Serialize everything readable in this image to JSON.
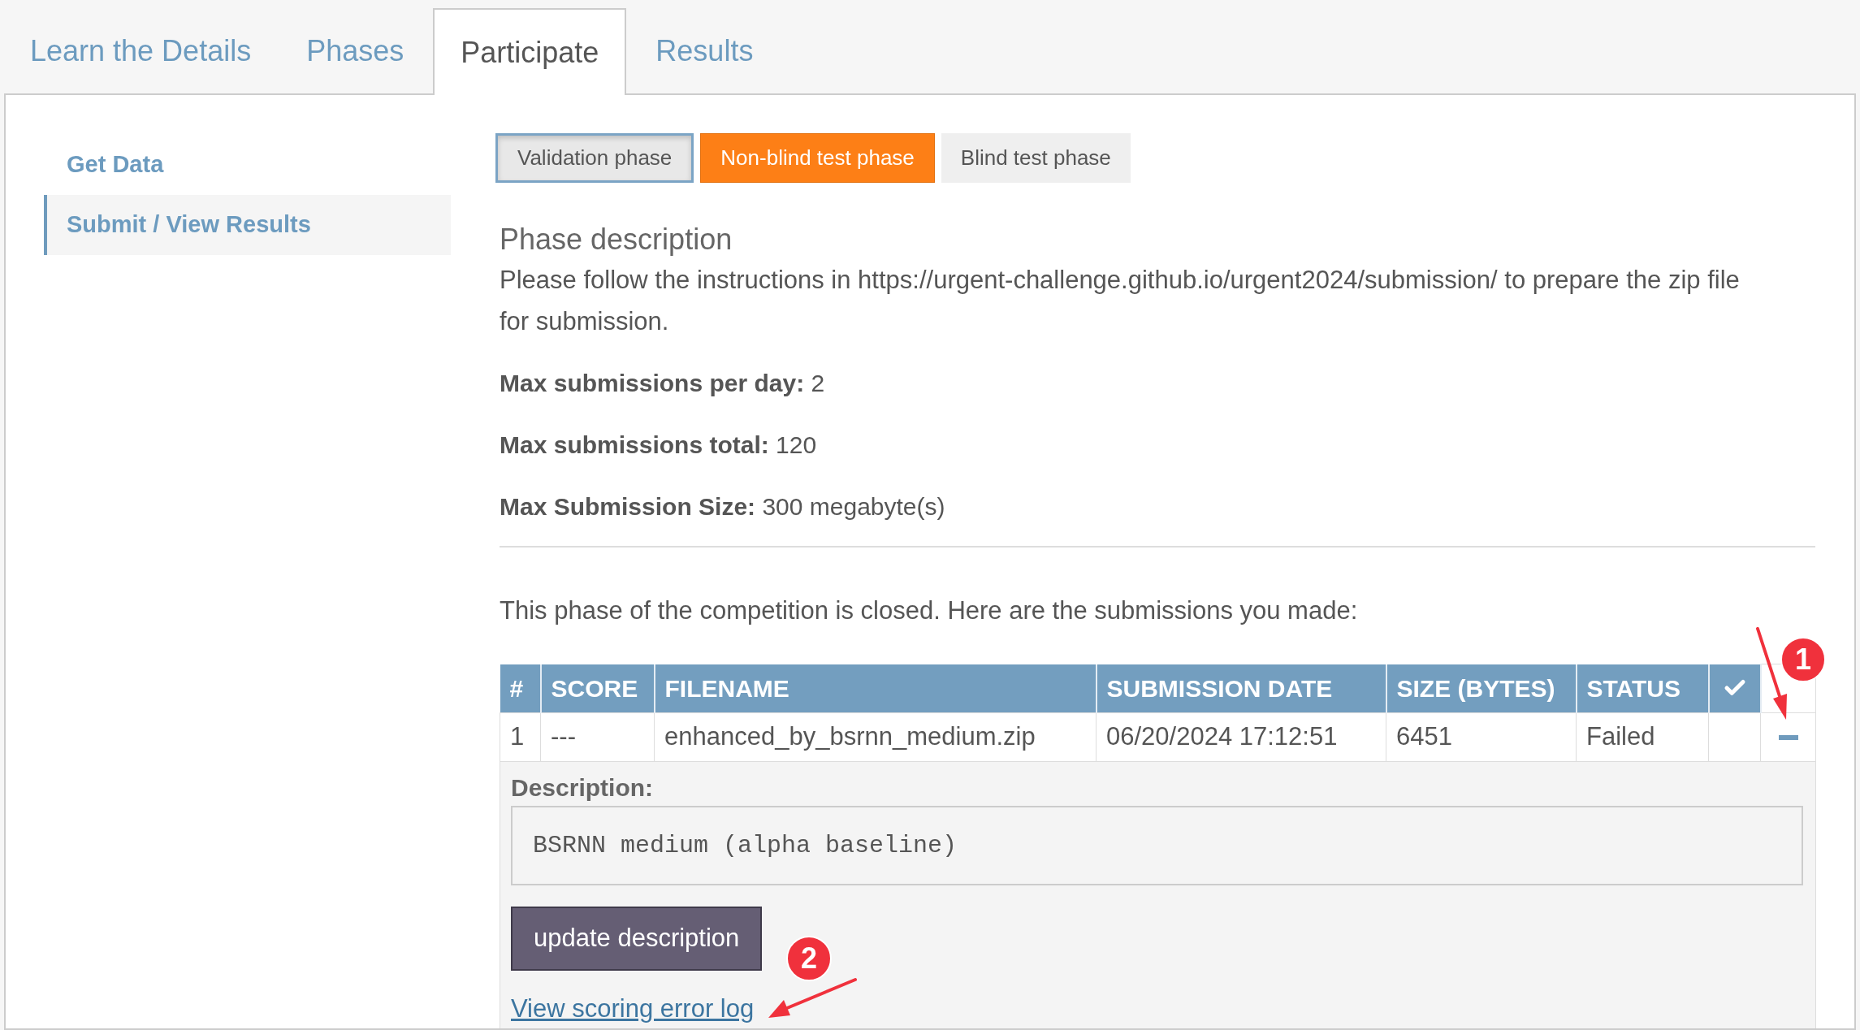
{
  "tabs": [
    {
      "label": "Learn the Details",
      "selected": false
    },
    {
      "label": "Phases",
      "selected": false
    },
    {
      "label": "Participate",
      "selected": true
    },
    {
      "label": "Results",
      "selected": false
    }
  ],
  "sidebar": {
    "items": [
      {
        "label": "Get Data",
        "selected": false
      },
      {
        "label": "Submit / View Results",
        "selected": true
      }
    ]
  },
  "phases": [
    {
      "label": "Validation phase",
      "selected": true,
      "active": false
    },
    {
      "label": "Non-blind test phase",
      "selected": false,
      "active": true
    },
    {
      "label": "Blind test phase",
      "selected": false,
      "active": false
    }
  ],
  "phase_description": {
    "title": "Phase description",
    "text": "Please follow the instructions in https://urgent-challenge.github.io/urgent2024/submission/ to prepare the zip file for submission.",
    "limits": [
      "**Max submissions per day:** 2",
      "**Max submissions total:** 120",
      "**Max Submission Size:** 300 megabyte(s)"
    ]
  },
  "submissions": {
    "intro": "This phase of the competition is closed. Here are the submissions you made:",
    "columns": [
      "#",
      "SCORE",
      "FILENAME",
      "SUBMISSION DATE",
      "SIZE (BYTES)",
      "STATUS"
    ],
    "rows": [
      {
        "cells": [
          "1",
          "---",
          "enhanced_by_bsrnn_medium.zip",
          "06/20/2024 17:12:51",
          "6451",
          "Failed"
        ],
        "expanded": true,
        "details": {
          "label": "Description:",
          "description": "BSRNN medium (alpha baseline)",
          "button": "update description",
          "link": "View scoring error log"
        }
      }
    ]
  },
  "annotations": [
    {
      "label": "1"
    },
    {
      "label": "2"
    }
  ]
}
